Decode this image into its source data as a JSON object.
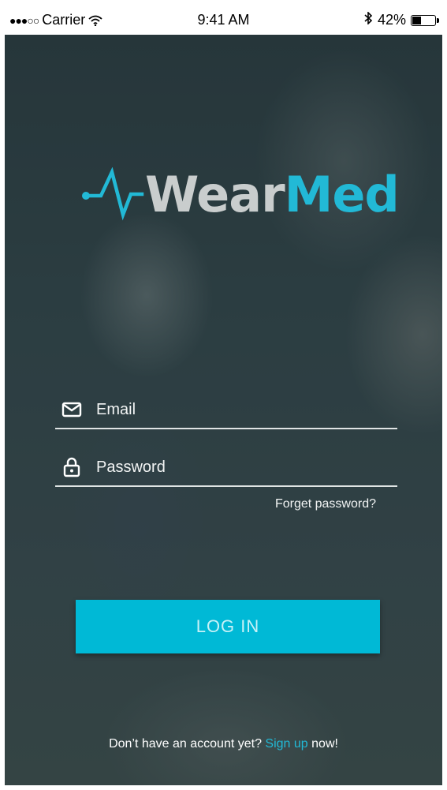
{
  "status_bar": {
    "signal_dots": "●●●○○",
    "carrier": "Carrier",
    "time": "9:41 AM",
    "bluetooth": "✱",
    "battery_text": "42%",
    "battery_level": 0.42
  },
  "brand": {
    "word_1": "Wear",
    "word_2": "Med",
    "accent_color": "#22b9d6",
    "logo_icon": "heartbeat-pulse-icon"
  },
  "form": {
    "email_placeholder": "Email",
    "email_icon": "envelope-icon",
    "password_placeholder": "Password",
    "password_icon": "lock-icon",
    "forgot_label": "Forget password?",
    "login_label": "LOG IN",
    "button_color": "#00b9d6"
  },
  "footer": {
    "prefix": "Don’t have an account yet?",
    "link": "Sign up",
    "suffix": "now!"
  }
}
